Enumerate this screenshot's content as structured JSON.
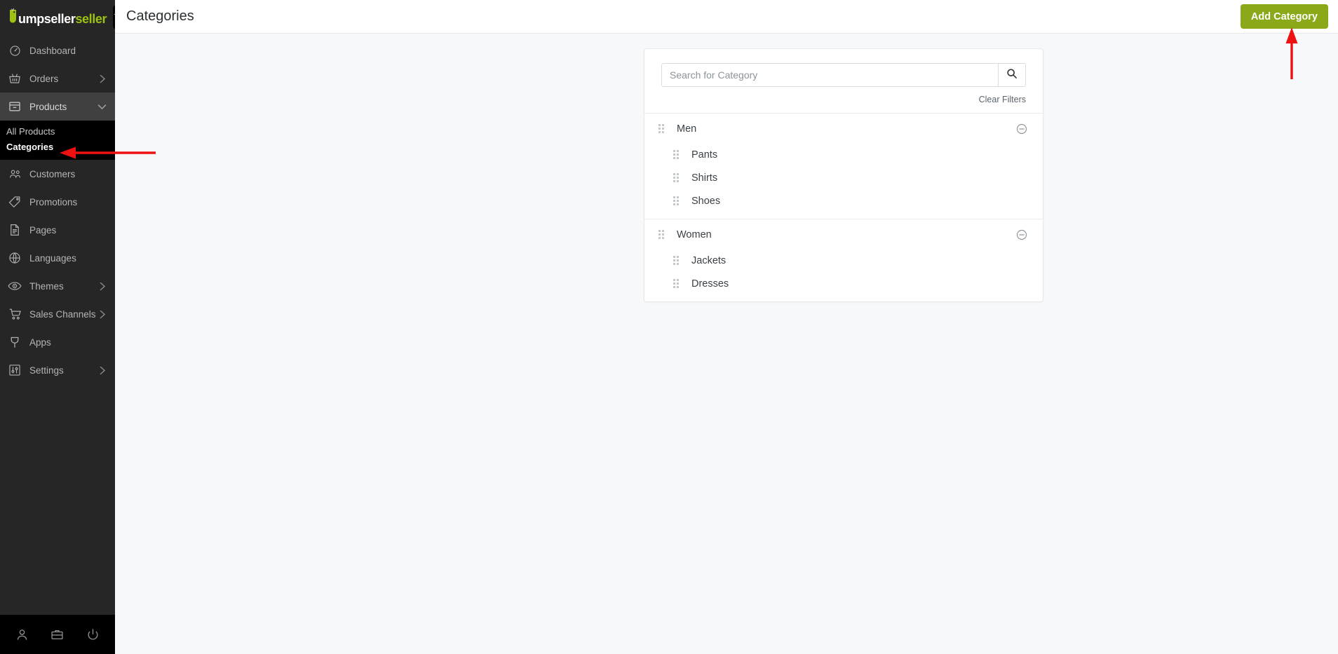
{
  "brand": {
    "name_white": "umpseller",
    "name_part_bold": "jump",
    "name_part_accent": "seller",
    "logo_text": "jumpseller",
    "accent_color": "#9cc313",
    "home_icon": "home-icon"
  },
  "sidebar": {
    "items": [
      {
        "label": "Dashboard",
        "icon": "gauge-icon",
        "chevron": false,
        "active": false
      },
      {
        "label": "Orders",
        "icon": "basket-icon",
        "chevron": true,
        "active": false
      },
      {
        "label": "Products",
        "icon": "box-icon",
        "chevron": true,
        "active": true,
        "expanded": true
      },
      {
        "label": "Customers",
        "icon": "users-icon",
        "chevron": false,
        "active": false
      },
      {
        "label": "Promotions",
        "icon": "tag-icon",
        "chevron": false,
        "active": false
      },
      {
        "label": "Pages",
        "icon": "document-icon",
        "chevron": false,
        "active": false
      },
      {
        "label": "Languages",
        "icon": "globe-icon",
        "chevron": false,
        "active": false
      },
      {
        "label": "Themes",
        "icon": "eye-icon",
        "chevron": true,
        "active": false
      },
      {
        "label": "Sales Channels",
        "icon": "cart-icon",
        "chevron": true,
        "active": false
      },
      {
        "label": "Apps",
        "icon": "plug-icon",
        "chevron": false,
        "active": false
      },
      {
        "label": "Settings",
        "icon": "sliders-icon",
        "chevron": true,
        "active": false
      }
    ],
    "products_submenu": [
      {
        "label": "All Products",
        "current": false
      },
      {
        "label": "Categories",
        "current": true
      }
    ],
    "footer_icons": [
      {
        "name": "user-icon"
      },
      {
        "name": "briefcase-icon"
      },
      {
        "name": "power-icon"
      }
    ]
  },
  "header": {
    "title": "Categories",
    "add_button_label": "Add Category",
    "add_button_color": "#8ba818"
  },
  "filters": {
    "search_placeholder": "Search for Category",
    "search_value": "",
    "search_button_icon": "search-icon",
    "clear_filters_label": "Clear Filters"
  },
  "categories": [
    {
      "name": "Men",
      "collapse_icon": "minus-circle-icon",
      "children": [
        {
          "name": "Pants"
        },
        {
          "name": "Shirts"
        },
        {
          "name": "Shoes"
        }
      ]
    },
    {
      "name": "Women",
      "collapse_icon": "minus-circle-icon",
      "children": [
        {
          "name": "Jackets"
        },
        {
          "name": "Dresses"
        }
      ]
    }
  ],
  "annotations": {
    "arrow_color": "#ee1111",
    "arrow_to_categories": "points-left-at-categories-menu-item",
    "arrow_to_add_category": "points-up-at-add-category-button"
  }
}
